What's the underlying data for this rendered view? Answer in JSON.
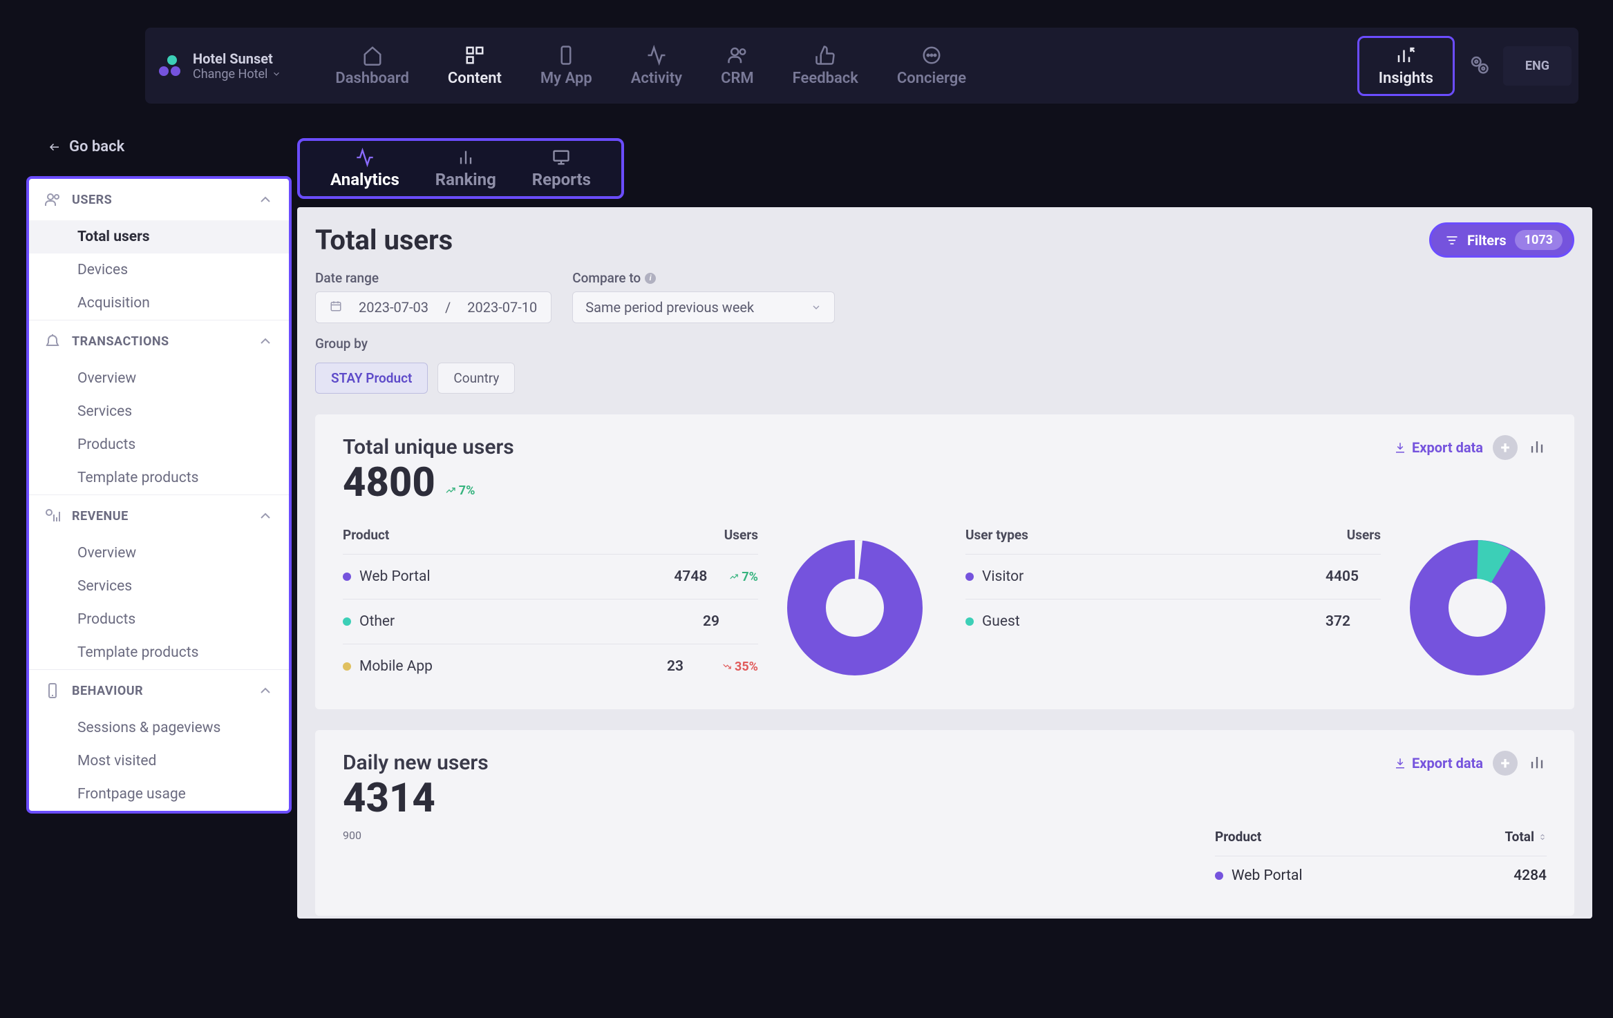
{
  "brand": {
    "title": "Hotel Sunset",
    "subtitle": "Change Hotel"
  },
  "nav": {
    "items": [
      {
        "label": "Dashboard"
      },
      {
        "label": "Content"
      },
      {
        "label": "My App"
      },
      {
        "label": "Activity"
      },
      {
        "label": "CRM"
      },
      {
        "label": "Feedback"
      },
      {
        "label": "Concierge"
      }
    ],
    "insights_label": "Insights",
    "lang": "ENG"
  },
  "go_back": "Go back",
  "sidebar": {
    "sections": [
      {
        "label": "USERS",
        "items": [
          "Total users",
          "Devices",
          "Acquisition"
        ]
      },
      {
        "label": "TRANSACTIONS",
        "items": [
          "Overview",
          "Services",
          "Products",
          "Template products"
        ]
      },
      {
        "label": "REVENUE",
        "items": [
          "Overview",
          "Services",
          "Products",
          "Template products"
        ]
      },
      {
        "label": "BEHAVIOUR",
        "items": [
          "Sessions & pageviews",
          "Most visited",
          "Frontpage usage"
        ]
      }
    ]
  },
  "subtabs": [
    "Analytics",
    "Ranking",
    "Reports"
  ],
  "page": {
    "title": "Total users",
    "filters_label": "Filters",
    "filters_count": "1073",
    "date_range_label": "Date range",
    "date_from": "2023-07-03",
    "date_sep": "/",
    "date_to": "2023-07-10",
    "compare_label": "Compare to",
    "compare_value": "Same period previous week",
    "groupby_label": "Group by",
    "groupby_opts": [
      "STAY Product",
      "Country"
    ]
  },
  "card1": {
    "title": "Total unique users",
    "export": "Export data",
    "value": "4800",
    "trend": "7%",
    "product_header": "Product",
    "users_header": "Users",
    "usertypes_header": "User types",
    "rows": [
      {
        "name": "Web Portal",
        "value": "4748",
        "trend": "7%",
        "color": "#7553dd"
      },
      {
        "name": "Other",
        "value": "29",
        "color": "#3ccfb7"
      },
      {
        "name": "Mobile App",
        "value": "23",
        "trend_down": "35%",
        "color": "#e0c060"
      }
    ],
    "types": [
      {
        "name": "Visitor",
        "value": "4405",
        "color": "#7553dd"
      },
      {
        "name": "Guest",
        "value": "372",
        "color": "#3ccfb7"
      }
    ]
  },
  "card2": {
    "title": "Daily new users",
    "export": "Export data",
    "value": "4314",
    "axis_hint": "900",
    "product_header": "Product",
    "total_header": "Total",
    "rows": [
      {
        "name": "Web Portal",
        "value": "4284",
        "color": "#7553dd"
      }
    ]
  },
  "chart_data": [
    {
      "type": "pie",
      "title": "Total unique users by Product",
      "series": [
        {
          "name": "Web Portal",
          "value": 4748,
          "color": "#7553dd"
        },
        {
          "name": "Other",
          "value": 29,
          "color": "#3ccfb7"
        },
        {
          "name": "Mobile App",
          "value": 23,
          "color": "#e0c060"
        }
      ]
    },
    {
      "type": "pie",
      "title": "Total unique users by User type",
      "series": [
        {
          "name": "Visitor",
          "value": 4405,
          "color": "#7553dd"
        },
        {
          "name": "Guest",
          "value": 372,
          "color": "#3ccfb7"
        }
      ]
    }
  ]
}
